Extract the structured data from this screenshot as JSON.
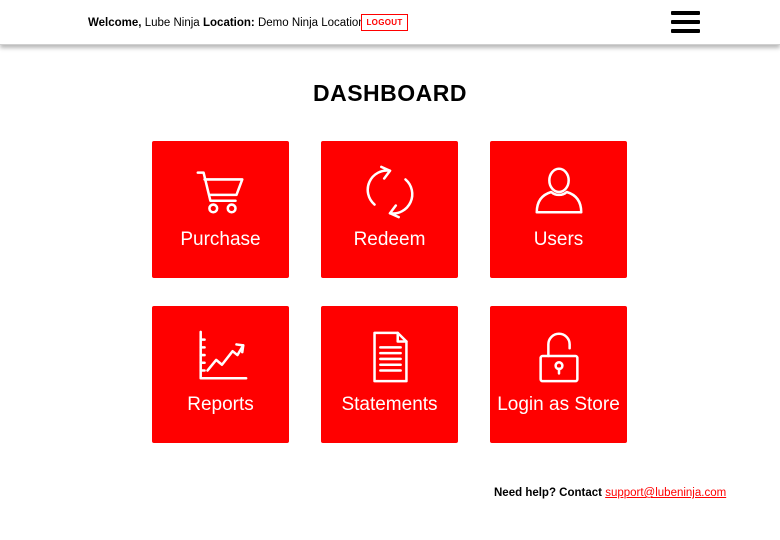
{
  "header": {
    "welcome_label": "Welcome,",
    "welcome_name": "Lube Ninja",
    "location_label": "Location:",
    "location_name": "Demo Ninja Location",
    "logout_label": "LOGOUT",
    "menu_icon": "hamburger-menu-icon"
  },
  "main": {
    "title": "DASHBOARD",
    "tiles": [
      {
        "label": "Purchase",
        "icon": "cart-icon"
      },
      {
        "label": "Redeem",
        "icon": "refresh-icon"
      },
      {
        "label": "Users",
        "icon": "user-icon"
      },
      {
        "label": "Reports",
        "icon": "chart-icon"
      },
      {
        "label": "Statements",
        "icon": "document-icon"
      },
      {
        "label": "Login as Store",
        "icon": "unlock-icon"
      }
    ]
  },
  "footer": {
    "help_label": "Need help? Contact",
    "support_email": "support@lubeninja.com"
  },
  "colors": {
    "accent": "#ff0000",
    "background": "#ffffff",
    "text": "#000000"
  }
}
